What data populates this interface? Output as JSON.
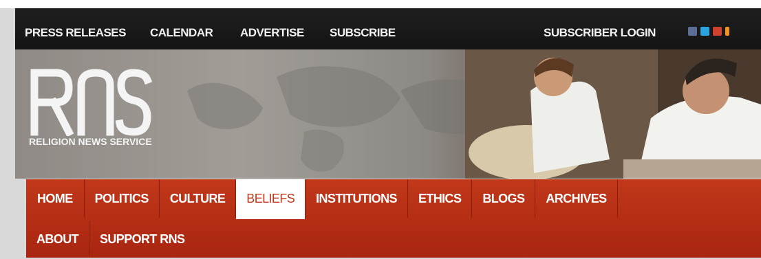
{
  "topbar": {
    "links": [
      "PRESS RELEASES",
      "CALENDAR",
      "ADVERTISE",
      "SUBSCRIBE"
    ],
    "login_label": "SUBSCRIBER LOGIN",
    "social_icons": [
      "facebook-icon",
      "twitter-icon",
      "google-plus-icon",
      "rss-icon"
    ]
  },
  "logo": {
    "letters": "RNS",
    "subtitle": "RELIGION NEWS SERVICE"
  },
  "nav": {
    "row1": [
      "HOME",
      "POLITICS",
      "CULTURE",
      "BELIEFS",
      "INSTITUTIONS",
      "ETHICS",
      "BLOGS",
      "ARCHIVES"
    ],
    "row2": [
      "ABOUT",
      "SUPPORT RNS"
    ],
    "active": "BELIEFS"
  },
  "colors": {
    "nav_red": "#b52d14",
    "topbar_black": "#1a1a1a",
    "active_text": "#c2381a"
  }
}
